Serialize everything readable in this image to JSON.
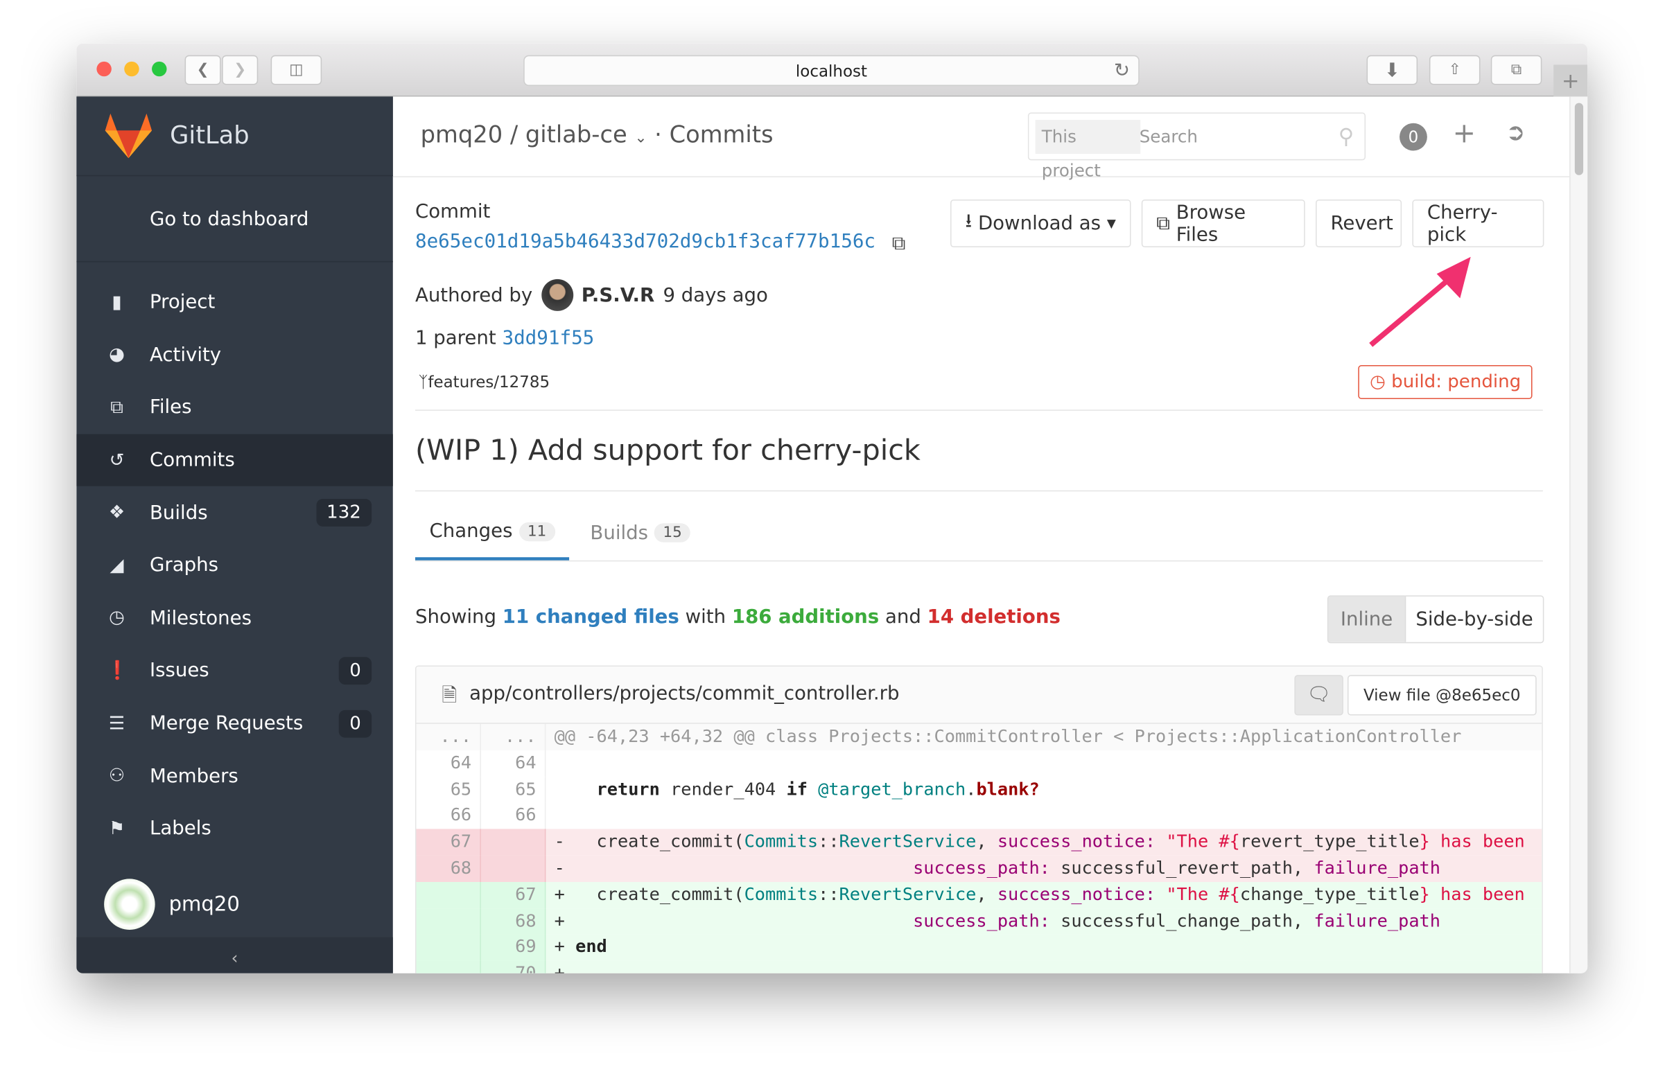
{
  "browser": {
    "url": "localhost"
  },
  "sidebar": {
    "brand": "GitLab",
    "dashboard": "Go to dashboard",
    "items": [
      {
        "label": "Project",
        "icon": "bookmark-icon"
      },
      {
        "label": "Activity",
        "icon": "dashboard-icon"
      },
      {
        "label": "Files",
        "icon": "files-icon"
      },
      {
        "label": "Commits",
        "icon": "history-icon",
        "active": true
      },
      {
        "label": "Builds",
        "icon": "cubes-icon",
        "count": "132"
      },
      {
        "label": "Graphs",
        "icon": "area-chart-icon"
      },
      {
        "label": "Milestones",
        "icon": "clock-icon"
      },
      {
        "label": "Issues",
        "icon": "exclamation-icon",
        "count": "0"
      },
      {
        "label": "Merge Requests",
        "icon": "list-icon",
        "count": "0"
      },
      {
        "label": "Members",
        "icon": "users-icon"
      },
      {
        "label": "Labels",
        "icon": "tags-icon"
      }
    ],
    "user": "pmq20"
  },
  "header": {
    "breadcrumb": "pmq20 / gitlab-ce",
    "page": "· Commits",
    "search_scope": "This project",
    "search_placeholder": "Search",
    "notifications": "0"
  },
  "commit": {
    "label": "Commit",
    "sha": "8e65ec01d19a5b46433d702d9cb1f3caf77b156c",
    "authored_by": "Authored by",
    "author": "P.S.V.R",
    "time": "9 days ago",
    "parent_label": "1 parent",
    "parent_sha": "3dd91f55",
    "branch": "features/12785",
    "build_status": "build: pending",
    "title": "(WIP 1) Add support for cherry-pick"
  },
  "actions": {
    "download": "Download as",
    "browse": "Browse Files",
    "revert": "Revert",
    "cherry_pick": "Cherry-pick"
  },
  "tabs": [
    {
      "label": "Changes",
      "count": "11"
    },
    {
      "label": "Builds",
      "count": "15"
    }
  ],
  "summary": {
    "showing": "Showing",
    "changed": "11 changed files",
    "with": "with",
    "additions": "186 additions",
    "and": "and",
    "deletions": "14 deletions"
  },
  "view_modes": {
    "inline": "Inline",
    "side": "Side-by-side"
  },
  "file": {
    "path": "app/controllers/projects/commit_controller.rb",
    "view_file": "View file @8e65ec0",
    "hunk": "@@ -64,23 +64,32 @@ class Projects::CommitController < Projects::ApplicationController"
  },
  "colors": {
    "accent_arrow": "#f0306f",
    "additions": "#3cab3c",
    "deletions": "#d22e2e",
    "link": "#2f7fbe"
  }
}
